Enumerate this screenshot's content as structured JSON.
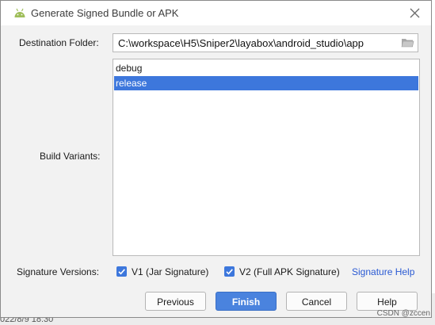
{
  "window": {
    "title": "Generate Signed Bundle or APK",
    "icon": "android-icon",
    "close_icon": "close-icon"
  },
  "destination": {
    "label": "Destination Folder:",
    "value": "C:\\workspace\\H5\\Sniper2\\layabox\\android_studio\\app",
    "browse_icon": "folder-icon"
  },
  "build_variants": {
    "label": "Build Variants:",
    "items": [
      {
        "label": "debug",
        "selected": false
      },
      {
        "label": "release",
        "selected": true
      }
    ]
  },
  "signature": {
    "label": "Signature Versions:",
    "v1": {
      "label": "V1 (Jar Signature)",
      "checked": true
    },
    "v2": {
      "label": "V2 (Full APK Signature)",
      "checked": true
    },
    "help_link": "Signature Help"
  },
  "buttons": {
    "previous": "Previous",
    "finish": "Finish",
    "cancel": "Cancel",
    "help": "Help"
  },
  "background": {
    "date_fragment": "022/8/9 18:30"
  },
  "watermark": "CSDN @zccen",
  "colors": {
    "accent": "#3d77dc",
    "link": "#2a5ad3",
    "android_green": "#9fbe5a"
  }
}
